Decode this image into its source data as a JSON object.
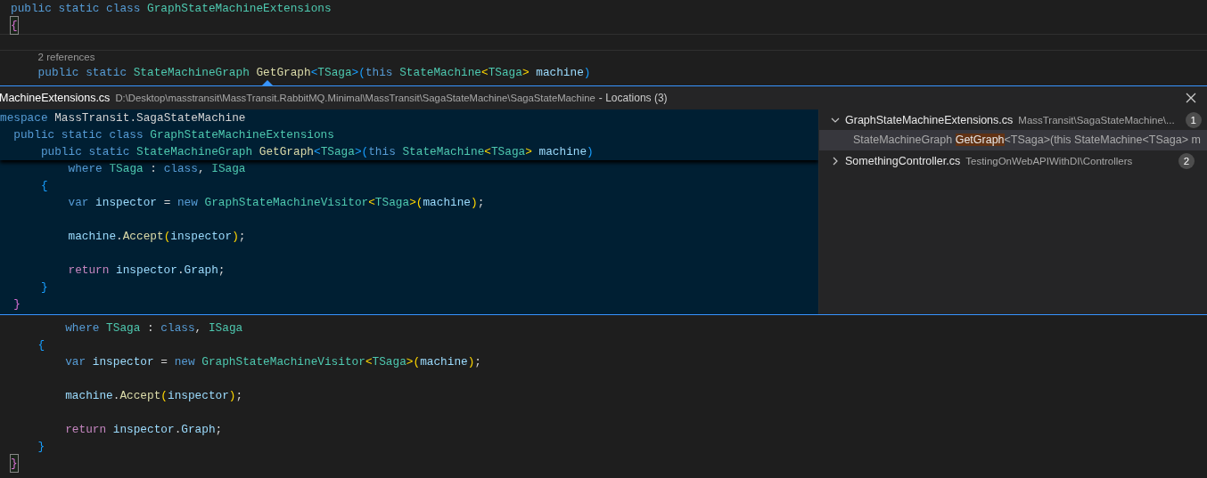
{
  "editor": {
    "lines": [
      {
        "kind": "code",
        "tokens": [
          {
            "text": "public static class ",
            "kind": "kw"
          },
          {
            "text": "GraphStateMachineExtensions",
            "kind": "type"
          }
        ]
      },
      {
        "kind": "code",
        "matched": true,
        "tokens": [
          {
            "text": "{",
            "kind": "b2"
          }
        ]
      },
      {
        "kind": "code",
        "current": true
      },
      {
        "kind": "codelens",
        "text": "2 references"
      },
      {
        "kind": "code",
        "tokens": [
          {
            "text": "    public static ",
            "kind": "kw"
          },
          {
            "text": "StateMachineGraph ",
            "kind": "type"
          },
          {
            "text": "GetGraph",
            "kind": "fn"
          },
          {
            "text": "<",
            "kind": "b3"
          },
          {
            "text": "TSaga",
            "kind": "type"
          },
          {
            "text": ">",
            "kind": "b3"
          },
          {
            "text": "(",
            "kind": "b3"
          },
          {
            "text": "this ",
            "kind": "kw"
          },
          {
            "text": "StateMachine",
            "kind": "type"
          },
          {
            "text": "<",
            "kind": "b1"
          },
          {
            "text": "TSaga",
            "kind": "type"
          },
          {
            "text": ">",
            "kind": "b1"
          },
          {
            "text": " machine",
            "kind": "var"
          },
          {
            "text": ")",
            "kind": "b3"
          }
        ]
      }
    ]
  },
  "peek": {
    "file": "MachineExtensions.cs",
    "path": "D:\\Desktop\\masstransit\\MassTransit.RabbitMQ.Minimal\\MassTransit\\SagaStateMachine\\SagaStateMachine",
    "title": "- Locations (3)",
    "sticky_lines": [
      {
        "kind": "code",
        "tokens": [
          {
            "text": "mespace ",
            "kind": "kw"
          },
          {
            "text": "MassTransit.SagaStateMachine",
            "kind": "punct"
          }
        ]
      },
      {
        "kind": "code",
        "tokens": [
          {
            "text": "  public static class ",
            "kind": "kw"
          },
          {
            "text": "GraphStateMachineExtensions",
            "kind": "type"
          }
        ]
      },
      {
        "kind": "code",
        "tokens": [
          {
            "text": "      public static ",
            "kind": "kw"
          },
          {
            "text": "StateMachineGraph ",
            "kind": "type"
          },
          {
            "text": "GetGraph",
            "kind": "fn"
          },
          {
            "text": "<",
            "kind": "b3"
          },
          {
            "text": "TSaga",
            "kind": "type"
          },
          {
            "text": ">",
            "kind": "b3"
          },
          {
            "text": "(",
            "kind": "b3"
          },
          {
            "text": "this ",
            "kind": "kw"
          },
          {
            "text": "StateMachine",
            "kind": "type"
          },
          {
            "text": "<",
            "kind": "b1"
          },
          {
            "text": "TSaga",
            "kind": "type"
          },
          {
            "text": ">",
            "kind": "b1"
          },
          {
            "text": " machine",
            "kind": "var"
          },
          {
            "text": ")",
            "kind": "b3"
          }
        ]
      }
    ],
    "lines": [
      {
        "kind": "code",
        "tokens": [
          {
            "text": "          where ",
            "kind": "kw"
          },
          {
            "text": "TSaga",
            "kind": "type"
          },
          {
            "text": " : ",
            "kind": "punct"
          },
          {
            "text": "class",
            "kind": "kw"
          },
          {
            "text": ", ",
            "kind": "punct"
          },
          {
            "text": "ISaga",
            "kind": "type"
          }
        ]
      },
      {
        "kind": "code",
        "tokens": [
          {
            "text": "      {",
            "kind": "b3"
          }
        ]
      },
      {
        "kind": "code",
        "tokens": [
          {
            "text": "          var ",
            "kind": "kw"
          },
          {
            "text": "inspector",
            "kind": "var"
          },
          {
            "text": " = ",
            "kind": "punct"
          },
          {
            "text": "new ",
            "kind": "kw"
          },
          {
            "text": "GraphStateMachineVisitor",
            "kind": "type"
          },
          {
            "text": "<",
            "kind": "b1"
          },
          {
            "text": "TSaga",
            "kind": "type"
          },
          {
            "text": ">",
            "kind": "b1"
          },
          {
            "text": "(",
            "kind": "b1"
          },
          {
            "text": "machine",
            "kind": "var"
          },
          {
            "text": ")",
            "kind": "b1"
          },
          {
            "text": ";",
            "kind": "punct"
          }
        ]
      },
      {
        "kind": "code"
      },
      {
        "kind": "code",
        "tokens": [
          {
            "text": "          machine",
            "kind": "var"
          },
          {
            "text": ".",
            "kind": "punct"
          },
          {
            "text": "Accept",
            "kind": "fn"
          },
          {
            "text": "(",
            "kind": "b1"
          },
          {
            "text": "inspector",
            "kind": "var"
          },
          {
            "text": ")",
            "kind": "b1"
          },
          {
            "text": ";",
            "kind": "punct"
          }
        ]
      },
      {
        "kind": "code"
      },
      {
        "kind": "code",
        "tokens": [
          {
            "text": "          return ",
            "kind": "ctrl"
          },
          {
            "text": "inspector",
            "kind": "var"
          },
          {
            "text": ".",
            "kind": "punct"
          },
          {
            "text": "Graph",
            "kind": "var"
          },
          {
            "text": ";",
            "kind": "punct"
          }
        ]
      },
      {
        "kind": "code",
        "tokens": [
          {
            "text": "      }",
            "kind": "b3"
          }
        ]
      },
      {
        "kind": "code",
        "tokens": [
          {
            "text": "  }",
            "kind": "b2"
          }
        ]
      }
    ],
    "references": [
      {
        "file": "GraphStateMachineExtensions.cs",
        "path": "MassTransit\\SagaStateMachine\\...",
        "count": "1",
        "expanded": true,
        "children": [
          {
            "before": "StateMachineGraph ",
            "match": "GetGraph",
            "after": "<TSaga>(this StateMachine<TSaga> m",
            "selected": true
          }
        ]
      },
      {
        "file": "SomethingController.cs",
        "path": "TestingOnWebAPIWithDI\\Controllers",
        "count": "2",
        "expanded": false
      }
    ]
  },
  "editor_bottom": {
    "lines": [
      {
        "kind": "code",
        "tokens": [
          {
            "text": "        where ",
            "kind": "kw"
          },
          {
            "text": "TSaga",
            "kind": "type"
          },
          {
            "text": " : ",
            "kind": "punct"
          },
          {
            "text": "class",
            "kind": "kw"
          },
          {
            "text": ", ",
            "kind": "punct"
          },
          {
            "text": "ISaga",
            "kind": "type"
          }
        ]
      },
      {
        "kind": "code",
        "tokens": [
          {
            "text": "    {",
            "kind": "b3"
          }
        ]
      },
      {
        "kind": "code",
        "tokens": [
          {
            "text": "        var ",
            "kind": "kw"
          },
          {
            "text": "inspector",
            "kind": "var"
          },
          {
            "text": " = ",
            "kind": "punct"
          },
          {
            "text": "new ",
            "kind": "kw"
          },
          {
            "text": "GraphStateMachineVisitor",
            "kind": "type"
          },
          {
            "text": "<",
            "kind": "b1"
          },
          {
            "text": "TSaga",
            "kind": "type"
          },
          {
            "text": ">",
            "kind": "b1"
          },
          {
            "text": "(",
            "kind": "b1"
          },
          {
            "text": "machine",
            "kind": "var"
          },
          {
            "text": ")",
            "kind": "b1"
          },
          {
            "text": ";",
            "kind": "punct"
          }
        ]
      },
      {
        "kind": "code"
      },
      {
        "kind": "code",
        "tokens": [
          {
            "text": "        machine",
            "kind": "var"
          },
          {
            "text": ".",
            "kind": "punct"
          },
          {
            "text": "Accept",
            "kind": "fn"
          },
          {
            "text": "(",
            "kind": "b1"
          },
          {
            "text": "inspector",
            "kind": "var"
          },
          {
            "text": ")",
            "kind": "b1"
          },
          {
            "text": ";",
            "kind": "punct"
          }
        ]
      },
      {
        "kind": "code"
      },
      {
        "kind": "code",
        "tokens": [
          {
            "text": "        return ",
            "kind": "ctrl"
          },
          {
            "text": "inspector",
            "kind": "var"
          },
          {
            "text": ".",
            "kind": "punct"
          },
          {
            "text": "Graph",
            "kind": "var"
          },
          {
            "text": ";",
            "kind": "punct"
          }
        ]
      },
      {
        "kind": "code",
        "tokens": [
          {
            "text": "    }",
            "kind": "b3"
          }
        ]
      },
      {
        "kind": "code",
        "matched": true,
        "tokens": [
          {
            "text": "}",
            "kind": "b2"
          }
        ]
      }
    ]
  }
}
